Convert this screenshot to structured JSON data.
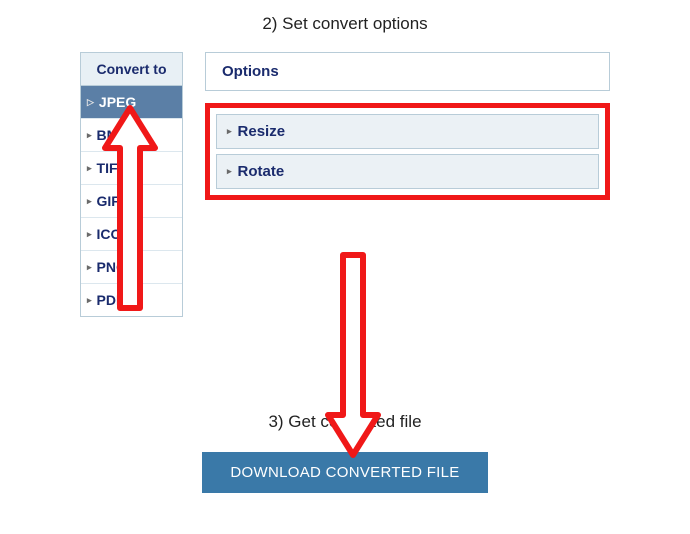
{
  "step2_title": "2) Set convert options",
  "sidebar": {
    "header": "Convert to",
    "items": [
      {
        "label": "JPEG",
        "selected": true
      },
      {
        "label": "BMP",
        "selected": false
      },
      {
        "label": "TIFF",
        "selected": false
      },
      {
        "label": "GIF",
        "selected": false
      },
      {
        "label": "ICO",
        "selected": false
      },
      {
        "label": "PNG",
        "selected": false
      },
      {
        "label": "PDF",
        "selected": false
      }
    ]
  },
  "options": {
    "header": "Options",
    "rows": [
      {
        "label": "Resize"
      },
      {
        "label": "Rotate"
      }
    ]
  },
  "step3_title": "3) Get converted file",
  "download_label": "DOWNLOAD CONVERTED FILE"
}
